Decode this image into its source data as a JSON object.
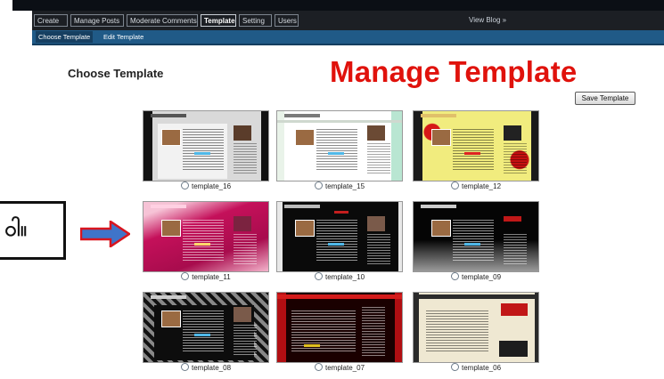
{
  "nav": {
    "tabs": [
      {
        "label": "Create"
      },
      {
        "label": "Manage Posts"
      },
      {
        "label": "Moderate Comments"
      },
      {
        "label": "Template"
      },
      {
        "label": "Setting"
      },
      {
        "label": "Users"
      }
    ],
    "view_blog": "View Blog »"
  },
  "subnav": {
    "items": [
      {
        "label": "Choose Template"
      },
      {
        "label": "Edit Template"
      }
    ]
  },
  "page": {
    "heading": "Choose Template",
    "overlay_title": "Manage Template",
    "save_button": "Save Template"
  },
  "callout": {
    "text": "ဝါ။"
  },
  "templates": [
    {
      "name": "template_16"
    },
    {
      "name": "template_15"
    },
    {
      "name": "template_12"
    },
    {
      "name": "template_11"
    },
    {
      "name": "template_10"
    },
    {
      "name": "template_09"
    },
    {
      "name": "template_08"
    },
    {
      "name": "template_07"
    },
    {
      "name": "template_06"
    }
  ],
  "colors": {
    "overlay_title": "#e0120c",
    "arrow_fill": "#3f74c9",
    "arrow_border": "#d8151f",
    "subnav": "#205a87"
  }
}
